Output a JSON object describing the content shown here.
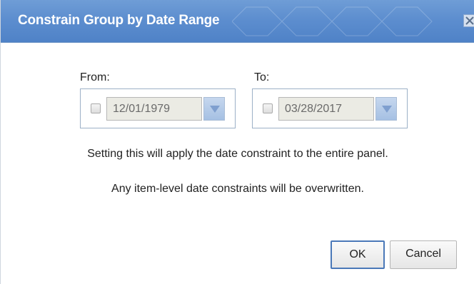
{
  "dialog": {
    "title": "Constrain Group by Date Range",
    "close_icon": "close-icon"
  },
  "from": {
    "label": "From:",
    "checked": false,
    "date": "12/01/1979",
    "dropdown_icon": "dropdown-arrow-icon"
  },
  "to": {
    "label": "To:",
    "checked": false,
    "date": "03/28/2017",
    "dropdown_icon": "dropdown-arrow-icon"
  },
  "messages": {
    "line1": "Setting this will apply the date constraint to the entire panel.",
    "line2": "Any item-level date constraints will be overwritten."
  },
  "buttons": {
    "ok": "OK",
    "cancel": "Cancel"
  },
  "colors": {
    "titlebar": "#5d8ecf",
    "title_text": "#ffffff",
    "ok_border": "#4a78b8"
  }
}
